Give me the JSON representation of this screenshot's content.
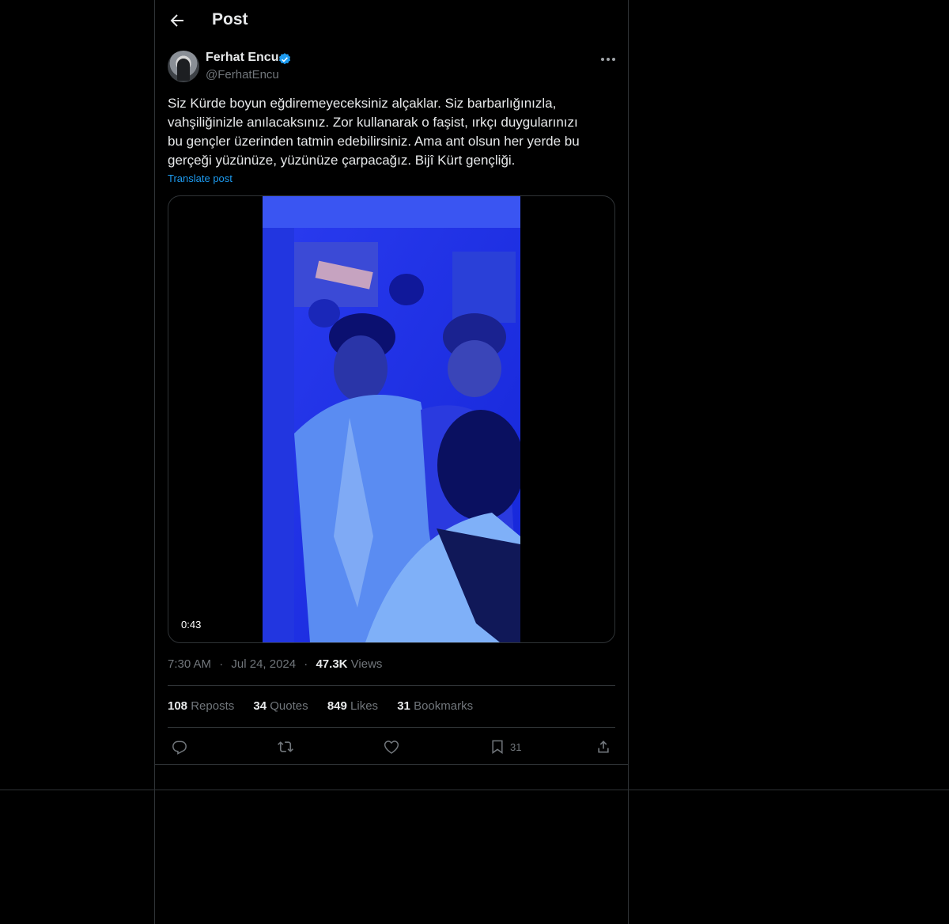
{
  "header": {
    "title": "Post",
    "back_icon": "arrow-left-icon"
  },
  "author": {
    "name": "Ferhat Encu",
    "handle": "@FerhatEncu",
    "verified_icon": "verified-badge-icon"
  },
  "post": {
    "text": "Siz Kürde boyun eğdiremeyeceksiniz alçaklar. Siz barbarlığınızla,\nvahşiliğinizle anılacaksınız. Zor kullanarak o faşist, ırkçı duygularınızı\nbu gençler üzerinden tatmin edebilirsiniz. Ama ant olsun her yerde bu\ngerçeği yüzünüze, yüzünüze çarpacağız. Bijî Kürt gençliği.",
    "translate_label": "Translate post",
    "video_duration": "0:43",
    "time": "7:30 AM",
    "dot1": "·",
    "date": "Jul 24, 2024",
    "dot2": "·",
    "views_count": "47.3K",
    "views_label": "Views"
  },
  "stats": {
    "reposts_count": "108",
    "reposts_label": "Reposts",
    "quotes_count": "34",
    "quotes_label": "Quotes",
    "likes_count": "849",
    "likes_label": "Likes",
    "bookmarks_count": "31",
    "bookmarks_label": "Bookmarks"
  },
  "actions": {
    "bookmark_count": "31"
  },
  "colors": {
    "accent": "#1d9bf0",
    "muted": "#71767b",
    "border": "#2f3336",
    "video_tint": "#1b2fe8"
  }
}
